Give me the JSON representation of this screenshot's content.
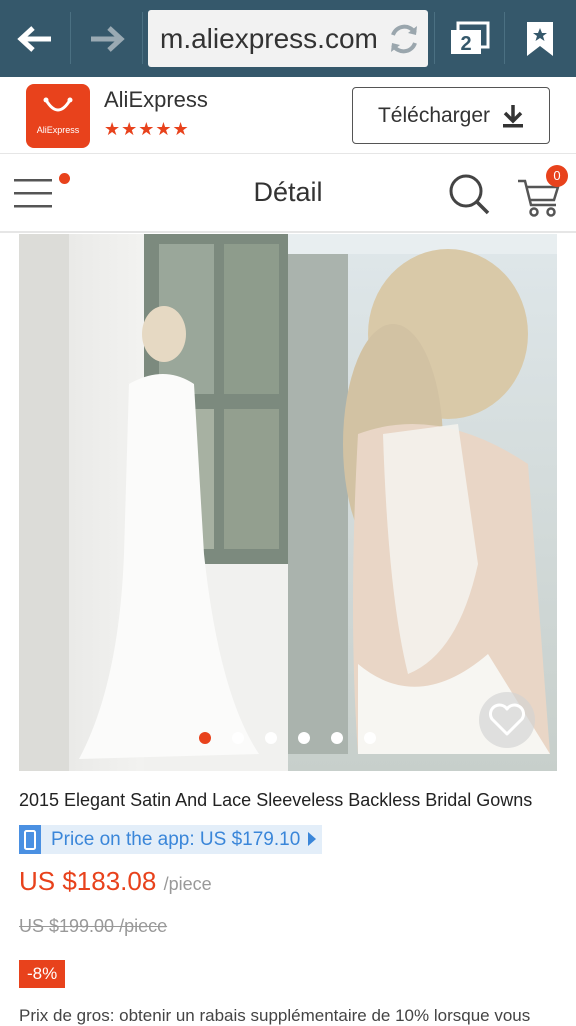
{
  "browser": {
    "url": "m.aliexpress.com",
    "tab_count": "2"
  },
  "app_banner": {
    "app_name": "AliExpress",
    "logo_text": "AliExpress",
    "rating_stars": "★★★★★",
    "download_label": "Télécharger"
  },
  "header": {
    "title": "Détail",
    "cart_count": "0"
  },
  "gallery": {
    "image_count": 6,
    "active_index": 0
  },
  "product": {
    "title": "2015 Elegant Satin And Lace Sleeveless Backless Bridal Gowns",
    "app_price_text": "Price on the app: US $179.10",
    "price": "US $183.08",
    "price_unit": "/piece",
    "old_price": "US $199.00 /piece",
    "discount": "-8%",
    "wholesale_text": "Prix de gros: obtenir un rabais supplémentaire de 10% lorsque vous"
  },
  "colors": {
    "browser_bar": "#35586b",
    "accent": "#e8421c",
    "app_price_blue": "#3a86d9"
  },
  "icons": [
    "back-arrow-icon",
    "forward-arrow-icon",
    "reload-icon",
    "tabs-icon",
    "bookmark-icon",
    "download-icon",
    "menu-icon",
    "search-icon",
    "cart-icon",
    "heart-icon",
    "phone-icon"
  ]
}
